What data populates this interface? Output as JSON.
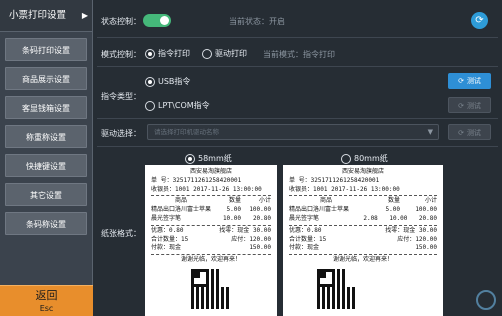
{
  "sidebar": {
    "title": "小票打印设置",
    "items": [
      {
        "label": "条码打印设置"
      },
      {
        "label": "商品展示设置"
      },
      {
        "label": "客显钱箱设置"
      },
      {
        "label": "称重称设置"
      },
      {
        "label": "快捷键设置"
      },
      {
        "label": "其它设置"
      },
      {
        "label": "条码称设置"
      }
    ],
    "back": {
      "label": "返回",
      "sub": "Esc"
    }
  },
  "status": {
    "label": "状态控制：",
    "current_label": "当前状态：开启",
    "enabled": true
  },
  "mode": {
    "label": "模式控制：",
    "options": [
      "指令打印",
      "驱动打印"
    ],
    "selected": 0,
    "current_label": "当前模式：指令打印"
  },
  "command_type": {
    "label": "指令类型：",
    "options": [
      "USB指令",
      "LPT\\COM指令"
    ],
    "selected": 0,
    "test_label": "测试"
  },
  "driver": {
    "label": "驱动选择：",
    "placeholder": "请选择打印机驱动名称",
    "test_label": "测试"
  },
  "paper": {
    "label": "纸张格式：",
    "options": [
      "58mm纸",
      "80mm纸"
    ],
    "selected": 0
  },
  "receipt": {
    "store": "西安易淘旗舰店",
    "order_label": "单  号：",
    "order_no": "3251711261258420001",
    "cashier_label": "收银员：",
    "cashier": "1001",
    "datetime": "2017-11-26 13:00:00",
    "headers": [
      "商品",
      "数量",
      "小计"
    ],
    "items": [
      {
        "name": "精品出口洛川富士苹果",
        "qty": "5.00",
        "sub": "100.00"
      },
      {
        "name": "晨光签字笔",
        "qty": "10.00",
        "sub": "20.80"
      }
    ],
    "items_80": [
      {
        "name": "精品出口洛川富士苹果",
        "price": "5.00",
        "qty": "100.00"
      },
      {
        "name": "晨光签字笔",
        "price": "2.08",
        "qty": "10.00",
        "sub": "20.80"
      }
    ],
    "discount_label": "优惠：",
    "discount": "0.80",
    "change_label": "找零：",
    "cash_label": "现金",
    "cash": "30.00",
    "count_label": "合计数量：",
    "count": "15",
    "paid_label": "应付：",
    "paid": "120.00",
    "pay_label": "付款：",
    "pay": "现金",
    "pay_amount": "150.00",
    "footer": "谢谢光临，欢迎再来！"
  },
  "colors": {
    "accent": "#2e8fd6",
    "toggle_on": "#45b87a",
    "back_button": "#e88e2c"
  }
}
